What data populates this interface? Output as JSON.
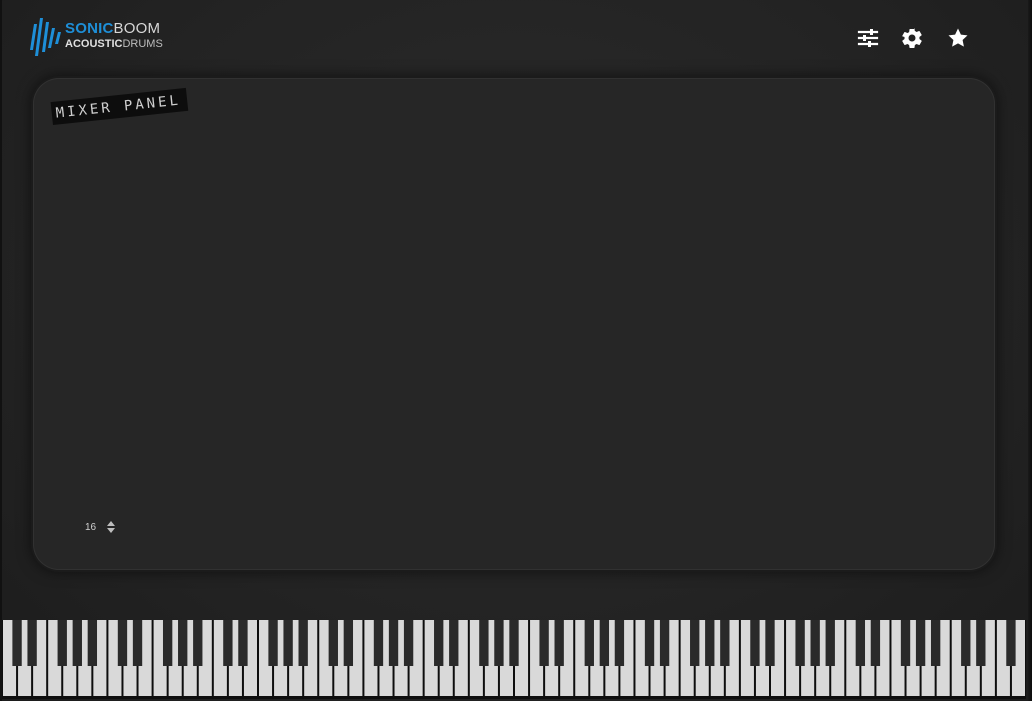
{
  "brand": {
    "line1_a": "SONIC",
    "line1_b": "BOOM",
    "line2_a": "ACOUSTIC",
    "line2_b": "DRUMS",
    "accent_color": "#1e8fd8"
  },
  "header": {
    "icons": [
      {
        "name": "mixer-sliders-icon"
      },
      {
        "name": "gear-icon"
      },
      {
        "name": "star-icon"
      }
    ]
  },
  "mixer": {
    "label": "MIXER PANEL",
    "channel_count": "16"
  },
  "keyboard": {
    "white_key_color": "#d9d9d9",
    "black_key_color": "#2a2a2a"
  }
}
